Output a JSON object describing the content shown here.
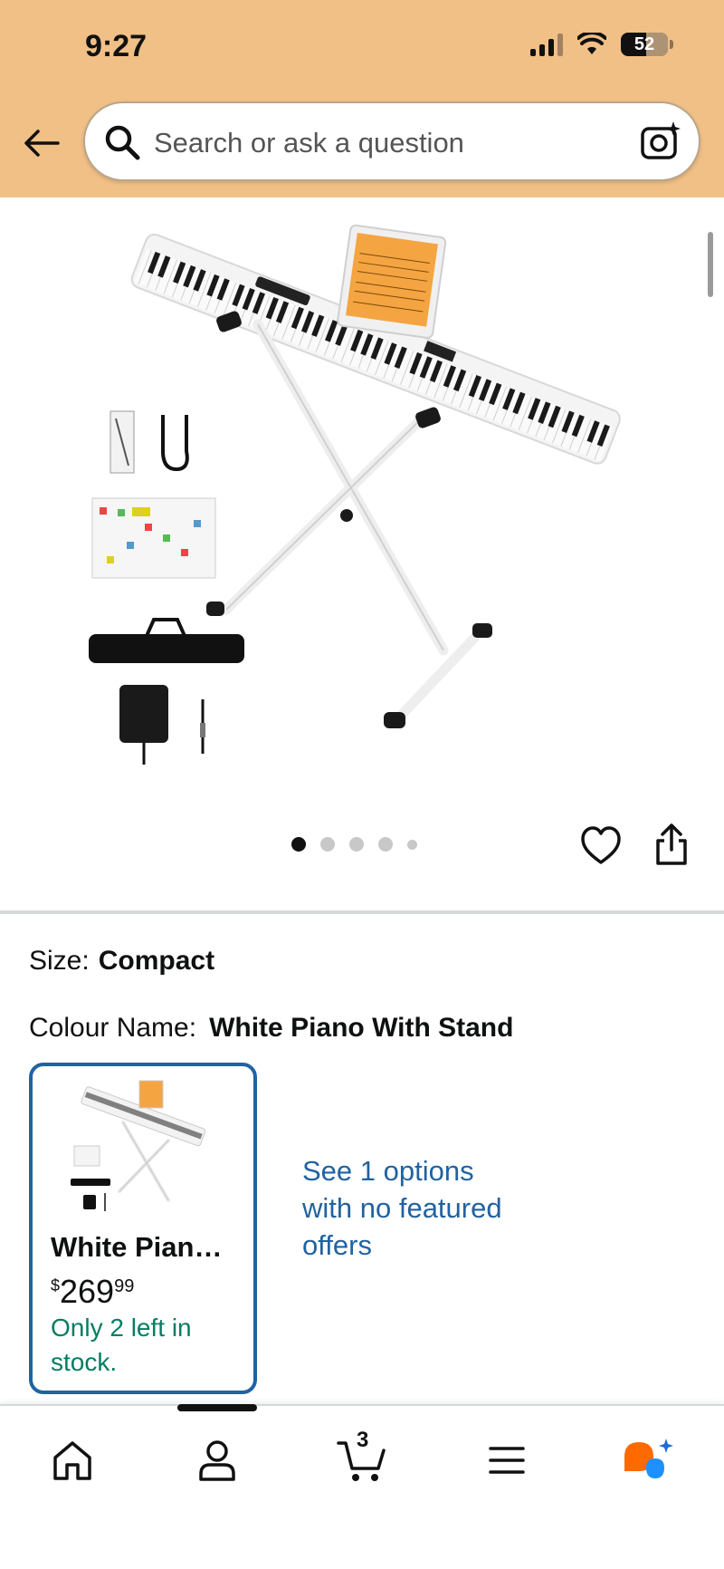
{
  "status_bar": {
    "time": "9:27",
    "battery": "52"
  },
  "search": {
    "placeholder": "Search or ask a question"
  },
  "icons": {
    "back": "back-arrow-icon",
    "search": "search-icon",
    "camera": "camera-lens-icon",
    "heart": "heart-icon",
    "share": "share-icon",
    "home": "home-icon",
    "account": "person-icon",
    "cart": "cart-icon",
    "menu": "menu-icon",
    "rufus": "rufus-icon"
  },
  "carousel": {
    "total_dots": 5,
    "active_index": 0
  },
  "product": {
    "size_label": "Size:",
    "size_value": "Compact",
    "colour_label": "Colour Name:",
    "colour_value": "White Piano With Stand",
    "variant": {
      "title": "White Pian…",
      "price_symbol": "$",
      "price_whole": "269",
      "price_cents": "99",
      "stock": "Only 2 left in stock."
    },
    "see_options": "See 1 options with no featured offers"
  },
  "bottom_nav": {
    "cart_count": "3"
  },
  "colors": {
    "header_bg": "#f1c086",
    "link_blue": "#2162a1",
    "stock_green": "#067d62",
    "rufus_orange": "#ff6a00",
    "rufus_blue": "#1e90ff"
  }
}
